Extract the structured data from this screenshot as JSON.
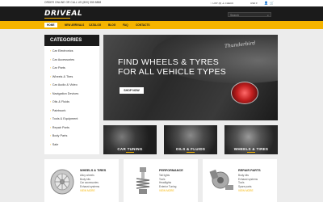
{
  "topbar": {
    "order_text": "ORDER ONLINE OR CALL US (800) 555 8888",
    "wishlist": "♡ LIST (0)  ♙ CHECK",
    "currency": "USD ▾"
  },
  "header": {
    "logo": "DRIVEAL",
    "search_placeholder": "Search"
  },
  "nav": {
    "items": [
      "HOME",
      "NEW ARRIVALS",
      "CATALOG",
      "BLOG",
      "FAQ",
      "CONTACTS"
    ]
  },
  "sidebar": {
    "title": "CATEGORIES",
    "items": [
      "Car Electronics",
      "Car Accessories",
      "Car Parts",
      "Wheels & Tires",
      "Car Audio & Video",
      "Navigation Devices",
      "Oils & Fluids",
      "Paintwork",
      "Tools & Equipment",
      "Repair Parts",
      "Body Parts",
      "Sale"
    ]
  },
  "hero": {
    "headline_1": "FIND WHEELS & TYRES",
    "headline_2": "FOR ALL VEHICLE TYPES",
    "script_text": "Thunderbird",
    "cta": "SHOP NOW"
  },
  "tiles": [
    {
      "label": "CAR TUNING"
    },
    {
      "label": "OILS & FLUIDS"
    },
    {
      "label": "WHEELS & TIRES"
    }
  ],
  "cards": [
    {
      "title": "WHEELS & TIRES",
      "lines": [
        "Alloy wheels",
        "Body kits",
        "Car accessories",
        "Exhaust systems"
      ],
      "more": "VIEW MORE"
    },
    {
      "title": "PERFORMANCE",
      "lines": [
        "Tail lights",
        "Tools",
        "Headlights",
        "Exterior Tuning"
      ],
      "more": "VIEW MORE"
    },
    {
      "title": "REPAIR PARTS",
      "lines": [
        "Body kits",
        "Exhaust systems",
        "Tools",
        "Spare parts"
      ],
      "more": "VIEW MORE"
    }
  ],
  "colors": {
    "accent": "#f5b400",
    "dark": "#1b1b1b",
    "background": "#ececec"
  }
}
